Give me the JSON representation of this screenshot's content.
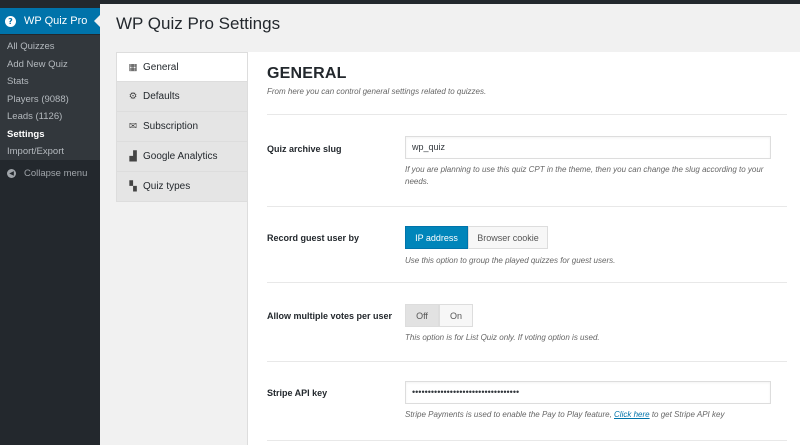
{
  "sidebar": {
    "plugin_title": "WP Quiz Pro",
    "plugin_icon": "question-icon",
    "items": [
      {
        "label": "All Quizzes"
      },
      {
        "label": "Add New Quiz"
      },
      {
        "label": "Stats"
      },
      {
        "label": "Players (9088)"
      },
      {
        "label": "Leads (1126)"
      },
      {
        "label": "Settings",
        "current": true
      },
      {
        "label": "Import/Export"
      }
    ],
    "collapse_label": "Collapse menu"
  },
  "page": {
    "title": "WP Quiz Pro Settings"
  },
  "tabs": [
    {
      "label": "General",
      "icon": "table-icon",
      "active": true
    },
    {
      "label": "Defaults",
      "icon": "gear-icon"
    },
    {
      "label": "Subscription",
      "icon": "envelope-icon"
    },
    {
      "label": "Google Analytics",
      "icon": "bar-chart-icon"
    },
    {
      "label": "Quiz types",
      "icon": "grid-icon"
    }
  ],
  "general": {
    "heading": "GENERAL",
    "description": "From here you can control general settings related to quizzes.",
    "archive_slug": {
      "label": "Quiz archive slug",
      "value": "wp_quiz",
      "help": "If you are planning to use this quiz CPT in the theme, then you can change the slug according to your needs."
    },
    "guest_user": {
      "label": "Record guest user by",
      "options": [
        "IP address",
        "Browser cookie"
      ],
      "selected": "IP address",
      "help": "Use this option to group the played quizzes for guest users."
    },
    "multiple_votes": {
      "label": "Allow multiple votes per user",
      "options": [
        "Off",
        "On"
      ],
      "selected": "Off",
      "help": "This option is for List Quiz only. If voting option is used."
    },
    "stripe": {
      "label": "Stripe API key",
      "value": "••••••••••••••••••••••••••••••••••",
      "help_before": "Stripe Payments is used to enable the Pay to Play feature, ",
      "help_link": "Click here",
      "help_after": " to get Stripe API key"
    }
  },
  "colors": {
    "sidebar_bg": "#23282d",
    "accent": "#0073aa",
    "primary_button": "#0085ba"
  }
}
